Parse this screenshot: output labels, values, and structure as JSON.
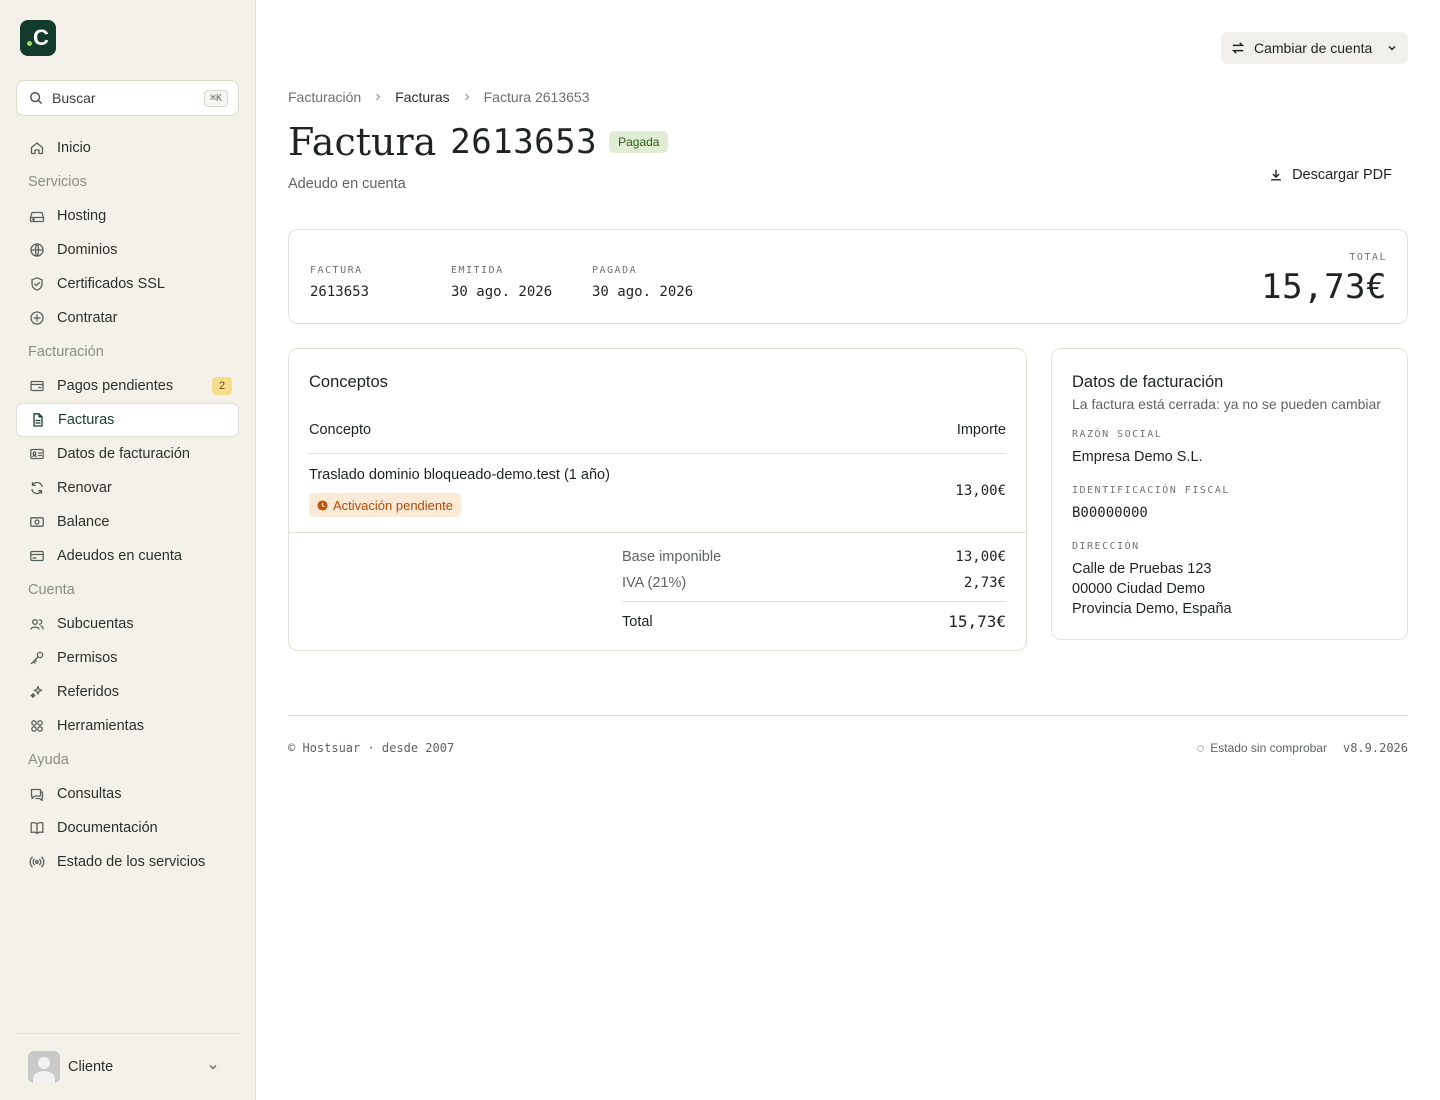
{
  "sidebar": {
    "logo_letter": "C",
    "search": {
      "placeholder": "Buscar",
      "shortcut": "⌘K"
    },
    "items": [
      {
        "type": "item",
        "label": "Inicio",
        "icon": "home-icon"
      },
      {
        "type": "section",
        "label": "Servicios"
      },
      {
        "type": "item",
        "label": "Hosting",
        "icon": "server-icon"
      },
      {
        "type": "item",
        "label": "Dominios",
        "icon": "globe-icon"
      },
      {
        "type": "item",
        "label": "Certificados SSL",
        "icon": "shield-icon"
      },
      {
        "type": "item",
        "label": "Contratar",
        "icon": "plus-circle-icon"
      },
      {
        "type": "section",
        "label": "Facturación"
      },
      {
        "type": "item",
        "label": "Pagos pendientes",
        "icon": "wallet-icon",
        "badge": "2"
      },
      {
        "type": "item",
        "label": "Facturas",
        "icon": "document-icon",
        "active": true
      },
      {
        "type": "item",
        "label": "Datos de facturación",
        "icon": "id-card-icon"
      },
      {
        "type": "item",
        "label": "Renovar",
        "icon": "refresh-icon"
      },
      {
        "type": "item",
        "label": "Balance",
        "icon": "banknote-icon"
      },
      {
        "type": "item",
        "label": "Adeudos en cuenta",
        "icon": "credit-card-icon"
      },
      {
        "type": "section",
        "label": "Cuenta"
      },
      {
        "type": "item",
        "label": "Subcuentas",
        "icon": "users-icon"
      },
      {
        "type": "item",
        "label": "Permisos",
        "icon": "key-icon"
      },
      {
        "type": "item",
        "label": "Referidos",
        "icon": "sparkles-icon"
      },
      {
        "type": "item",
        "label": "Herramientas",
        "icon": "grid-icon"
      },
      {
        "type": "section",
        "label": "Ayuda"
      },
      {
        "type": "item",
        "label": "Consultas",
        "icon": "chat-icon"
      },
      {
        "type": "item",
        "label": "Documentación",
        "icon": "book-icon"
      },
      {
        "type": "item",
        "label": "Estado de los servicios",
        "icon": "broadcast-icon"
      }
    ],
    "user": {
      "name": "Cliente"
    }
  },
  "header": {
    "switch_account_label": "Cambiar de cuenta",
    "breadcrumb": [
      "Facturación",
      "Facturas",
      "Factura 2613653"
    ],
    "title_word": "Factura",
    "title_number": "2613653",
    "status": "Pagada",
    "subtitle": "Adeudo en cuenta",
    "download_label": "Descargar PDF"
  },
  "summary": {
    "invoice": {
      "label": "FACTURA",
      "value": "2613653"
    },
    "issued": {
      "label": "EMITIDA",
      "value": "30 ago. 2026"
    },
    "paid": {
      "label": "PAGADA",
      "value": "30 ago. 2026"
    },
    "total": {
      "label": "TOTAL",
      "value": "15,73€"
    }
  },
  "concepts": {
    "title": "Conceptos",
    "col_concept": "Concepto",
    "col_amount": "Importe",
    "rows": [
      {
        "concept": "Traslado dominio bloqueado-demo.test (1 año)",
        "status": "Activación pendiente",
        "amount": "13,00€"
      }
    ],
    "base_label": "Base imponible",
    "base_value": "13,00€",
    "tax_label": "IVA (21%)",
    "tax_value": "2,73€",
    "total_label": "Total",
    "total_value": "15,73€"
  },
  "billing": {
    "title": "Datos de facturación",
    "note": "La factura está cerrada: ya no se pueden cambiar",
    "company_label": "RAZÓN SOCIAL",
    "company": "Empresa Demo S.L.",
    "taxid_label": "IDENTIFICACIÓN FISCAL",
    "taxid": "B00000000",
    "address_label": "DIRECCIÓN",
    "address_line1": "Calle de Pruebas 123",
    "address_line2": "00000 Ciudad Demo",
    "address_line3": "Provincia Demo, España"
  },
  "footer": {
    "copyright": "© Hostsuar · desde 2007",
    "status": "Estado sin comprobar",
    "version": "v8.9.2026"
  },
  "colors": {
    "brand": "#123b2c",
    "sidebar_bg": "#f4f1ea",
    "paid_badge_bg": "#e1ecd4",
    "pending_badge_bg": "#fbead6",
    "pending_badge_text": "#b54b06",
    "count_badge_bg": "#f6dd8c"
  }
}
